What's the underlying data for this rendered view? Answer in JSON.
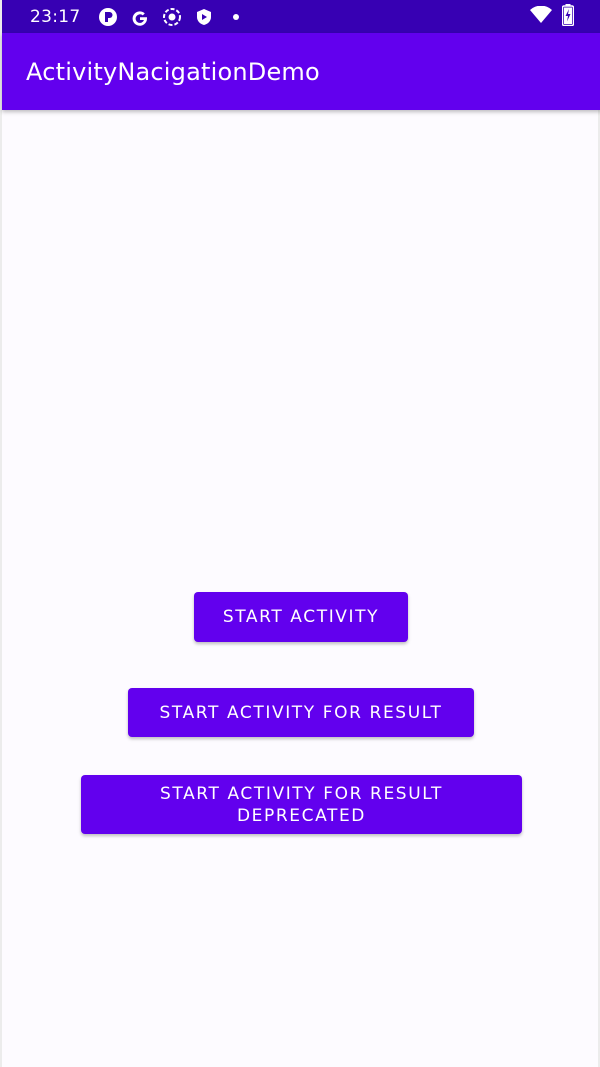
{
  "status_bar": {
    "time": "23:17",
    "left_icons": [
      "notification-app-icon",
      "google-icon",
      "cast-icon",
      "shield-icon",
      "more-dot-icon"
    ],
    "right_icons": [
      "wifi-icon",
      "battery-charging-icon"
    ]
  },
  "app_bar": {
    "title": "ActivityNacigationDemo"
  },
  "buttons": {
    "start_activity": "START ACTIVITY",
    "start_activity_for_result": "START ACTIVITY FOR RESULT",
    "start_activity_for_result_deprecated": "START ACTIVITY FOR RESULT DEPRECATED"
  },
  "colors": {
    "status_bar": "#3700b3",
    "primary": "#6200ee",
    "background": "#fdfbff",
    "on_primary": "#ffffff"
  }
}
